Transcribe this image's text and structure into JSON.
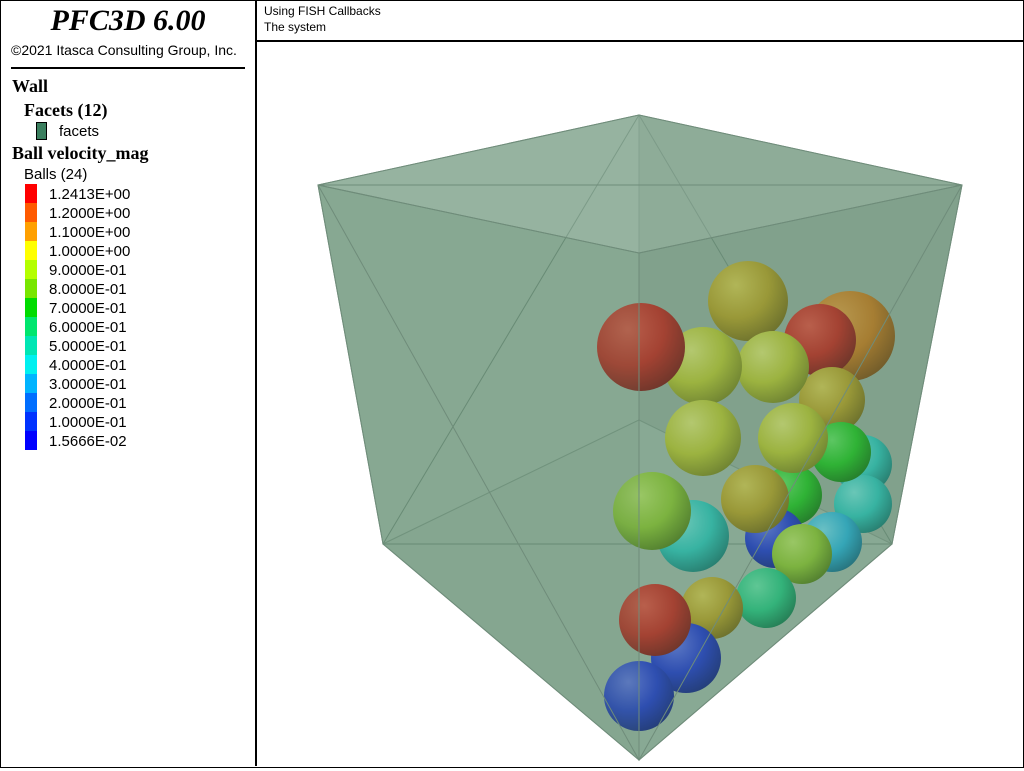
{
  "app": {
    "title": "PFC3D 6.00",
    "copyright": "©2021 Itasca Consulting Group, Inc."
  },
  "legend": {
    "wall_header": "Wall",
    "facets_header": "Facets (12)",
    "facets_label": "facets",
    "facets_color": "#3b7f5f",
    "ball_header": "Ball velocity_mag",
    "balls_label": "Balls (24)",
    "scale": [
      {
        "label": "1.2413E+00",
        "color": "#ff0000"
      },
      {
        "label": "1.2000E+00",
        "color": "#ff5a00"
      },
      {
        "label": "1.1000E+00",
        "color": "#ffa000"
      },
      {
        "label": "1.0000E+00",
        "color": "#ffff00"
      },
      {
        "label": "9.0000E-01",
        "color": "#b4ff00"
      },
      {
        "label": "8.0000E-01",
        "color": "#78e600"
      },
      {
        "label": "7.0000E-01",
        "color": "#00dc00"
      },
      {
        "label": "6.0000E-01",
        "color": "#00e66e"
      },
      {
        "label": "5.0000E-01",
        "color": "#00e6b4"
      },
      {
        "label": "4.0000E-01",
        "color": "#00f0f0"
      },
      {
        "label": "3.0000E-01",
        "color": "#00b4ff"
      },
      {
        "label": "2.0000E-01",
        "color": "#006eff"
      },
      {
        "label": "1.0000E-01",
        "color": "#0032ff"
      },
      {
        "label": "1.5666E-02",
        "color": "#0000ff"
      }
    ]
  },
  "plot": {
    "title": "Using FISH Callbacks",
    "subtitle": "The system"
  }
}
